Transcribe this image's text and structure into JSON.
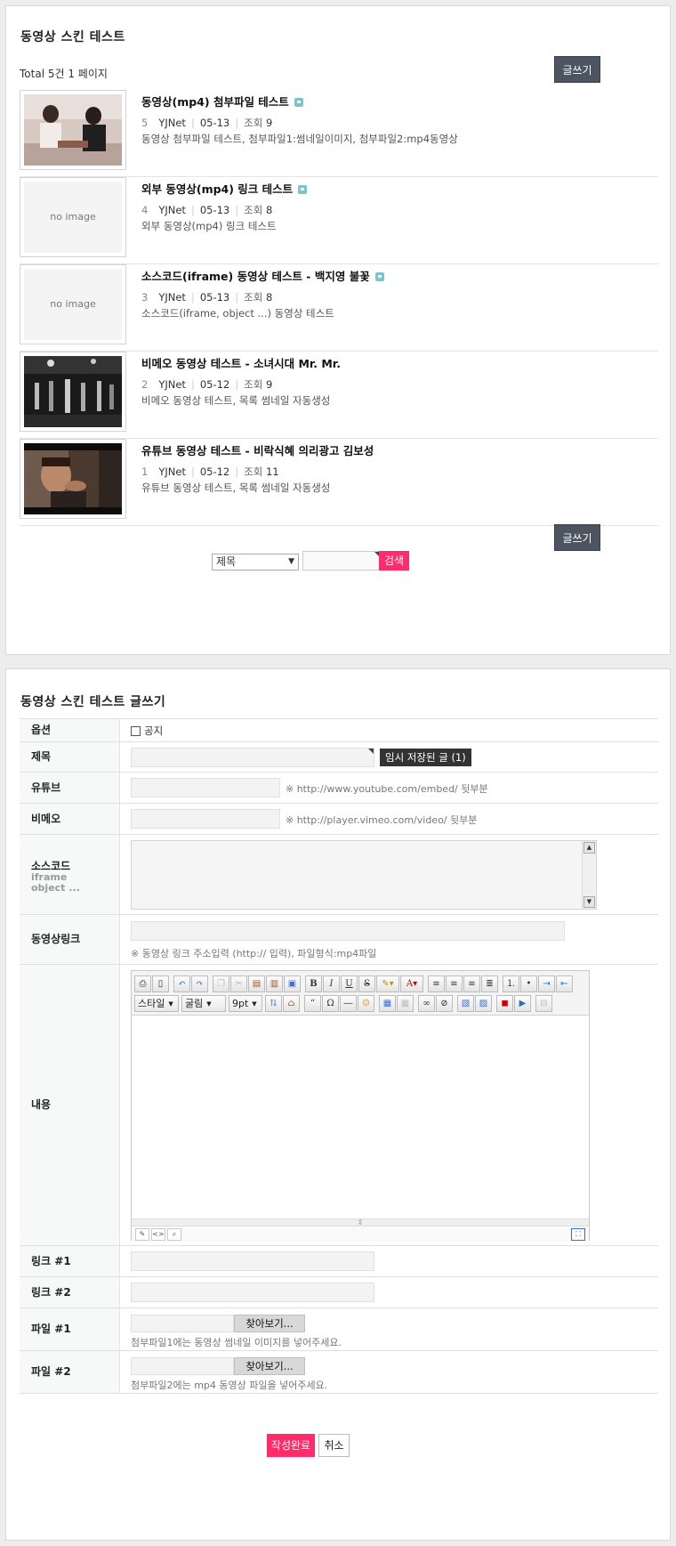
{
  "list": {
    "title": "동영상 스킨 테스트",
    "total": "Total 5건 1 페이지",
    "write_label": "글쓰기",
    "items": [
      {
        "title": "동영상(mp4) 첨부파일 테스트",
        "num": "5",
        "author": "YJNet",
        "date": "05-13",
        "hit_label": "조회",
        "hits": "9",
        "desc": "동영상 첨부파일 테스트, 첨부파일1:썸네일이미지, 첨부파일2:mp4동영상",
        "thumb": "image"
      },
      {
        "title": "외부 동영상(mp4) 링크 테스트",
        "num": "4",
        "author": "YJNet",
        "date": "05-13",
        "hit_label": "조회",
        "hits": "8",
        "desc": "외부 동영상(mp4) 링크 테스트",
        "thumb": "no image"
      },
      {
        "title": "소스코드(iframe) 동영상 테스트 - 백지영 불꽃",
        "num": "3",
        "author": "YJNet",
        "date": "05-13",
        "hit_label": "조회",
        "hits": "8",
        "desc": "소스코드(iframe, object ...) 동영상 테스트",
        "thumb": "no image"
      },
      {
        "title": "비메오 동영상 테스트 - 소녀시대 Mr. Mr.",
        "num": "2",
        "author": "YJNet",
        "date": "05-12",
        "hit_label": "조회",
        "hits": "9",
        "desc": "비메오 동영상 테스트, 목록 썸네일 자동생성",
        "thumb": "image"
      },
      {
        "title": "유튜브 동영상 테스트 - 비락식혜 의리광고 김보성",
        "num": "1",
        "author": "YJNet",
        "date": "05-12",
        "hit_label": "조회",
        "hits": "11",
        "desc": "유튜브 동영상 테스트, 목록 썸네일 자동생성",
        "thumb": "image"
      }
    ],
    "search": {
      "select_value": "제목",
      "button": "검색"
    }
  },
  "form": {
    "title": "동영상 스킨 테스트 글쓰기",
    "labels": {
      "option": "옵션",
      "subject": "제목",
      "youtube": "유튜브",
      "vimeo": "비메오",
      "source": "소스코드",
      "source_sub1": "iframe",
      "source_sub2": "object ...",
      "video_link": "동영상링크",
      "content": "내용",
      "link1": "링크 #1",
      "link2": "링크 #2",
      "file1": "파일 #1",
      "file2": "파일 #2"
    },
    "notice_label": "공지",
    "temp_saved": "임시 저장된 글 (1)",
    "youtube_hint": "※ http://www.youtube.com/embed/ 뒷부분",
    "vimeo_hint": "※ http://player.vimeo.com/video/ 뒷부분",
    "video_link_hint": "※ 동영상 링크 주소입력 (http:// 입력), 파일형식:mp4파일",
    "editor": {
      "style": "스타일",
      "font": "굴림",
      "size": "9pt"
    },
    "browse": "찾아보기...",
    "file1_hint": "첨부파일1에는 동영상 썸네일 이미지를 넣어주세요.",
    "file2_hint": "첨부파일2에는 mp4 동영상 파일을 넣어주세요.",
    "submit": "작성완료",
    "cancel": "취소"
  },
  "colors": {
    "accent": "#ff2b6b",
    "dark_button": "#4d5560"
  }
}
